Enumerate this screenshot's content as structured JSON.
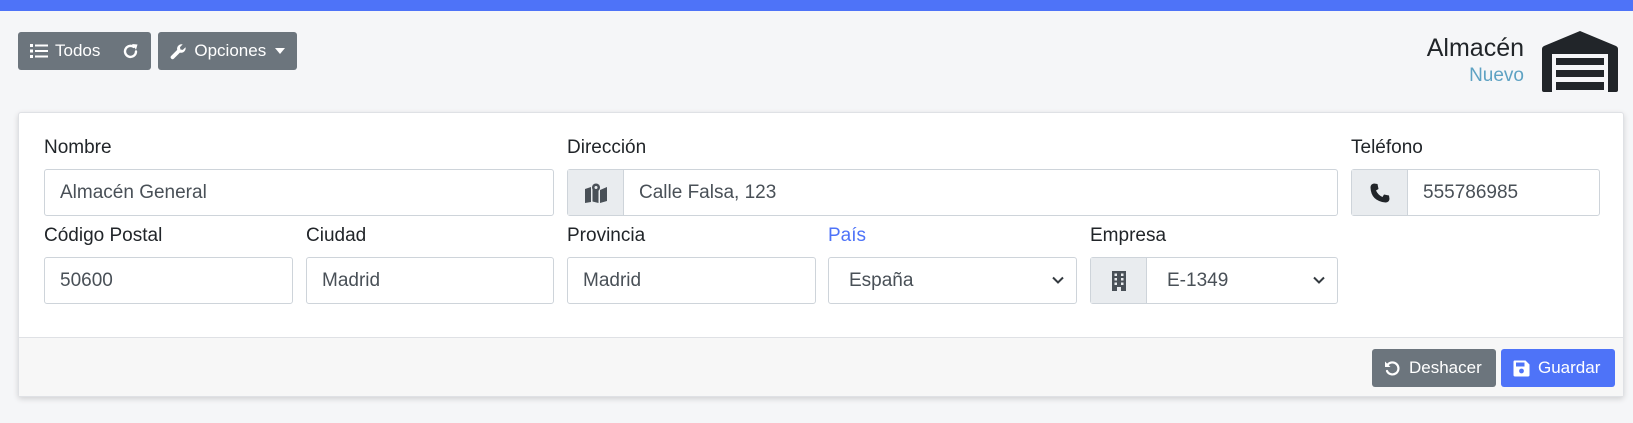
{
  "toolbar": {
    "todos_label": "Todos",
    "opciones_label": "Opciones"
  },
  "header": {
    "title": "Almacén",
    "subtitle": "Nuevo"
  },
  "form": {
    "nombre": {
      "label": "Nombre",
      "value": "Almacén General"
    },
    "direccion": {
      "label": "Dirección",
      "value": "Calle Falsa, 123"
    },
    "telefono": {
      "label": "Teléfono",
      "value": "555786985"
    },
    "codigo_postal": {
      "label": "Código Postal",
      "value": "50600"
    },
    "ciudad": {
      "label": "Ciudad",
      "value": "Madrid"
    },
    "provincia": {
      "label": "Provincia",
      "value": "Madrid"
    },
    "pais": {
      "label": "País",
      "value": "España"
    },
    "empresa": {
      "label": "Empresa",
      "value": "E-1349"
    }
  },
  "footer": {
    "undo_label": "Deshacer",
    "save_label": "Guardar"
  },
  "colors": {
    "accent": "#4e73f8",
    "secondary": "#6c757d",
    "subtitle": "#5ea2c3"
  }
}
